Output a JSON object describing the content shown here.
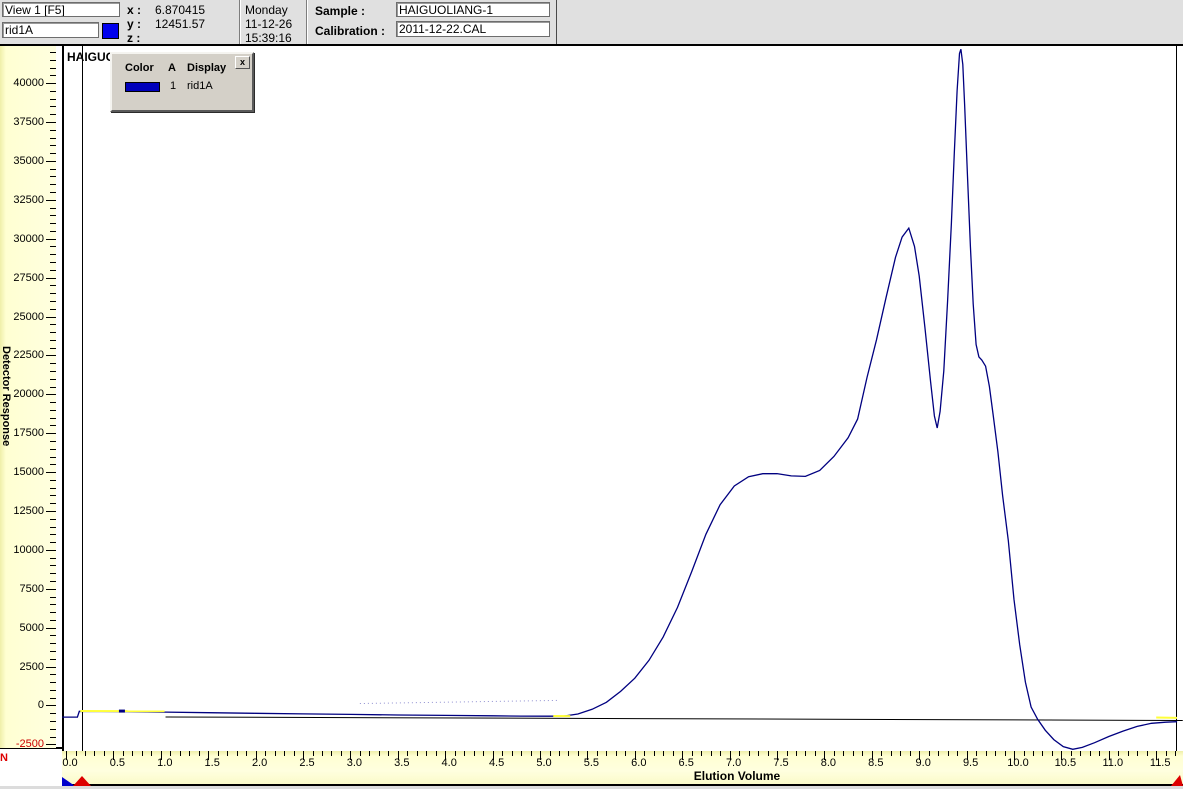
{
  "toolbar": {
    "view_selector": {
      "value": "View 1 [F5]"
    },
    "trace_field": {
      "value": "rid1A"
    },
    "trace_color": "#0000ee",
    "cursor": {
      "x_label": "x :",
      "x_value": "6.870415",
      "y_label": "y :",
      "y_value": "12451.57",
      "z_label": "z :",
      "z_value": ""
    },
    "datetime": {
      "day": "Monday",
      "date": "11-12-26",
      "time": "15:39:16"
    },
    "sample": {
      "label": "Sample :",
      "value": "HAIGUOLIANG-1"
    },
    "calibration": {
      "label": "Calibration :",
      "value": "2011-12-22.CAL"
    }
  },
  "legend": {
    "close_label": "x",
    "columns": {
      "color": "Color",
      "a": "A",
      "display": "Display"
    },
    "row": {
      "a": "1",
      "display": "rid1A",
      "swatch_color": "#0000bb"
    }
  },
  "chart": {
    "title": "HAIGUOLIANG-1",
    "y_axis_label": "Detector Response",
    "x_axis_label": "Elution Volume",
    "left_margin_letter": "N",
    "marker_colors": {
      "blue": "#0000cc",
      "red": "#dd0000"
    }
  },
  "chart_data": {
    "type": "line",
    "title": "HAIGUOLIANG-1",
    "xlabel": "Elution Volume",
    "ylabel": "Detector Response",
    "xlim": [
      0,
      11.78
    ],
    "ylim": [
      -2740,
      42400
    ],
    "grid": false,
    "y_major_ticks": [
      40000,
      37500,
      35000,
      32500,
      30000,
      27500,
      25000,
      22500,
      20000,
      17500,
      15000,
      12500,
      10000,
      7500,
      5000,
      2500,
      0,
      -2500
    ],
    "y_minor_step": 500,
    "x_major_tick_labels": [
      "0.0",
      "0.5",
      "1.0",
      "1.5",
      "2.0",
      "2.5",
      "3.0",
      "3.5",
      "4.0",
      "4.5",
      "5.0",
      "5.5",
      "6.0",
      "6.5",
      "7.0",
      "7.5",
      "8.0",
      "8.5",
      "9.0",
      "9.5",
      "10.0",
      "10.5",
      "11.0",
      "11.5"
    ],
    "x_major_step": 0.5,
    "x_minor_step": 0.1,
    "negative_tick_color": "#cc0000",
    "series": [
      {
        "name": "rid1A",
        "color": "#000080",
        "points": [
          [
            -0.04,
            -750
          ],
          [
            0.12,
            -750
          ],
          [
            0.14,
            -380
          ],
          [
            0.6,
            -400
          ],
          [
            1.05,
            -430
          ],
          [
            1.5,
            -470
          ],
          [
            2.0,
            -510
          ],
          [
            2.5,
            -545
          ],
          [
            3.0,
            -580
          ],
          [
            3.5,
            -615
          ],
          [
            4.0,
            -645
          ],
          [
            4.5,
            -670
          ],
          [
            4.8,
            -685
          ],
          [
            5.1,
            -695
          ],
          [
            5.25,
            -690
          ],
          [
            5.4,
            -550
          ],
          [
            5.55,
            -250
          ],
          [
            5.7,
            200
          ],
          [
            5.85,
            900
          ],
          [
            6.0,
            1750
          ],
          [
            6.15,
            2900
          ],
          [
            6.3,
            4400
          ],
          [
            6.45,
            6300
          ],
          [
            6.6,
            8600
          ],
          [
            6.75,
            11000
          ],
          [
            6.9,
            12900
          ],
          [
            7.05,
            14100
          ],
          [
            7.2,
            14700
          ],
          [
            7.35,
            14890
          ],
          [
            7.5,
            14900
          ],
          [
            7.65,
            14750
          ],
          [
            7.8,
            14720
          ],
          [
            7.95,
            15100
          ],
          [
            8.1,
            16000
          ],
          [
            8.25,
            17200
          ],
          [
            8.35,
            18400
          ],
          [
            8.45,
            21100
          ],
          [
            8.55,
            23500
          ],
          [
            8.65,
            26200
          ],
          [
            8.75,
            28800
          ],
          [
            8.82,
            30100
          ],
          [
            8.89,
            30680
          ],
          [
            8.95,
            29500
          ],
          [
            9.0,
            27600
          ],
          [
            9.06,
            24300
          ],
          [
            9.12,
            20800
          ],
          [
            9.16,
            18600
          ],
          [
            9.19,
            17830
          ],
          [
            9.22,
            18900
          ],
          [
            9.26,
            21500
          ],
          [
            9.3,
            26000
          ],
          [
            9.34,
            31000
          ],
          [
            9.37,
            35500
          ],
          [
            9.4,
            39500
          ],
          [
            9.425,
            41900
          ],
          [
            9.44,
            42180
          ],
          [
            9.46,
            41200
          ],
          [
            9.48,
            38500
          ],
          [
            9.51,
            34000
          ],
          [
            9.54,
            29500
          ],
          [
            9.57,
            25800
          ],
          [
            9.6,
            23200
          ],
          [
            9.63,
            22400
          ],
          [
            9.66,
            22200
          ],
          [
            9.7,
            21800
          ],
          [
            9.74,
            20500
          ],
          [
            9.78,
            18700
          ],
          [
            9.83,
            16300
          ],
          [
            9.88,
            13500
          ],
          [
            9.94,
            10600
          ],
          [
            10.0,
            6800
          ],
          [
            10.06,
            3900
          ],
          [
            10.12,
            1500
          ],
          [
            10.18,
            -100
          ],
          [
            10.25,
            -900
          ],
          [
            10.33,
            -1600
          ],
          [
            10.42,
            -2200
          ],
          [
            10.52,
            -2650
          ],
          [
            10.62,
            -2820
          ],
          [
            10.72,
            -2700
          ],
          [
            10.85,
            -2400
          ],
          [
            11.0,
            -2000
          ],
          [
            11.15,
            -1650
          ],
          [
            11.3,
            -1350
          ],
          [
            11.45,
            -1150
          ],
          [
            11.6,
            -1080
          ],
          [
            11.72,
            -1050
          ]
        ]
      }
    ],
    "overlays": {
      "integration_baseline": {
        "x1": 1.05,
        "y1": -745,
        "x2": 11.78,
        "y2": -970,
        "color": "#000000"
      },
      "baseline_segments_color": "#ffff3a",
      "baseline_segments": [
        {
          "x1": 0.15,
          "y1": -360,
          "x2": 1.04,
          "y2": -370
        },
        {
          "x1": 5.14,
          "y1": -680,
          "x2": 5.32,
          "y2": -690
        },
        {
          "x1": 11.5,
          "y1": -780,
          "x2": 11.72,
          "y2": -800
        }
      ],
      "marker_dot": {
        "x": 0.59,
        "y": -365,
        "color": "#000080"
      },
      "faint_dotted_segment": {
        "x1": 3.1,
        "y1": 120,
        "x2": 5.18,
        "y2": 320,
        "color": "#3333aa"
      }
    }
  }
}
